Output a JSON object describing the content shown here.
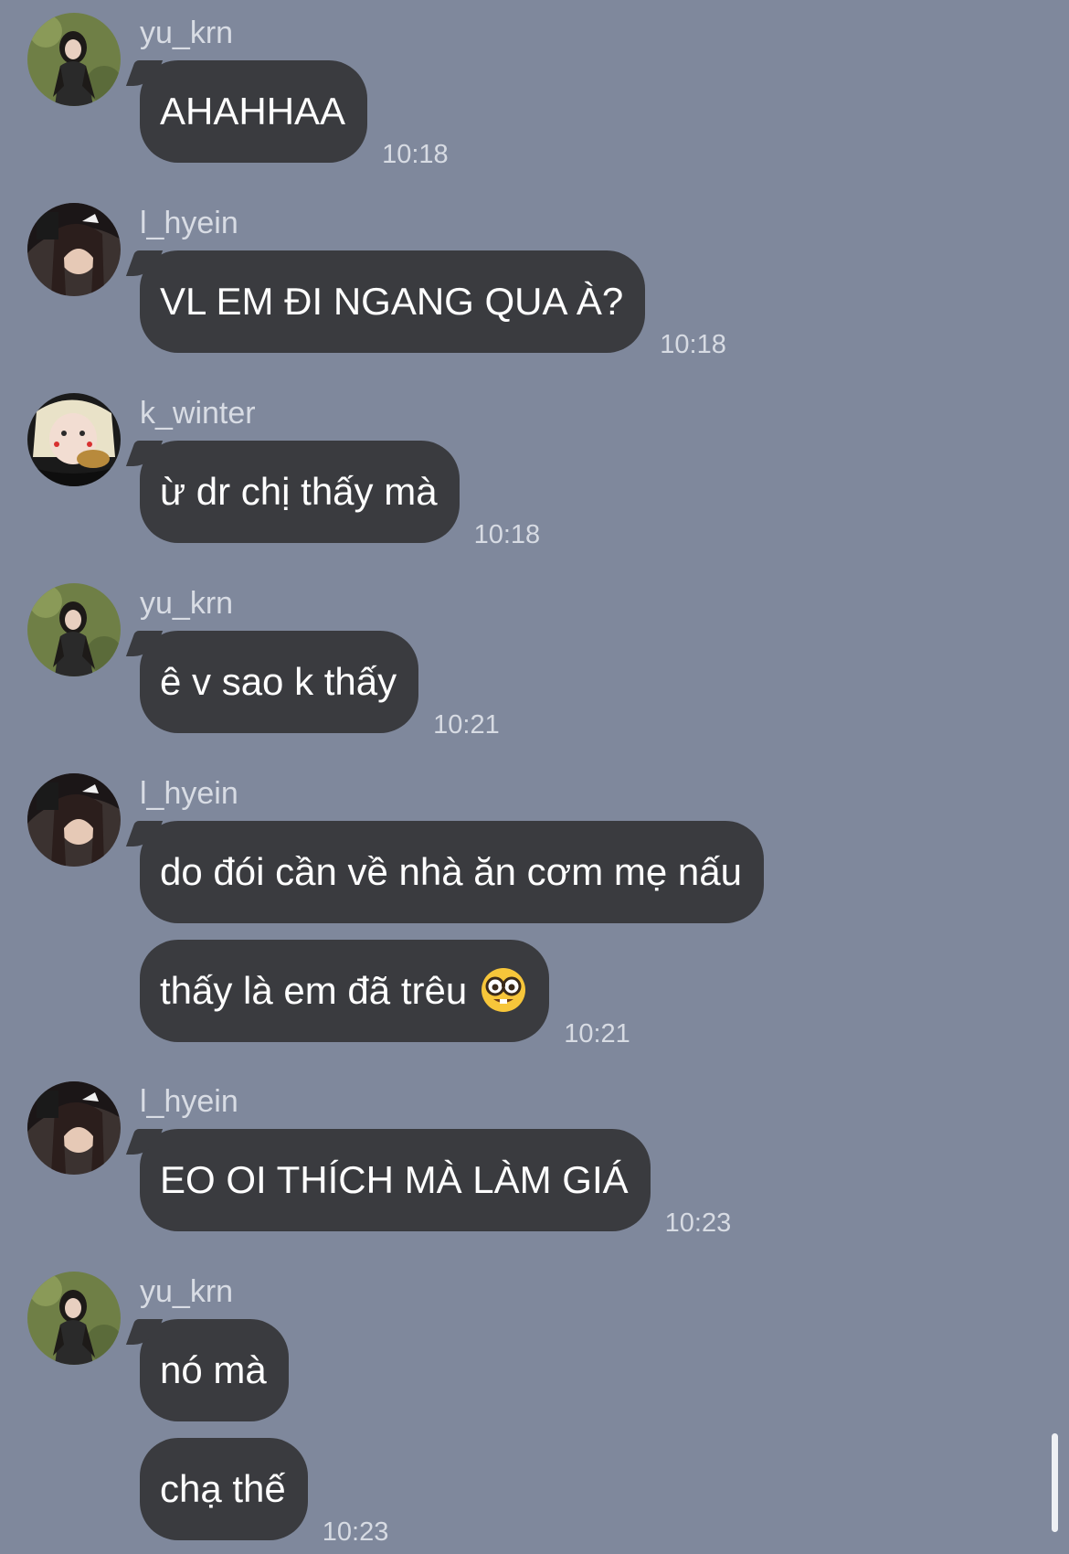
{
  "colors": {
    "background": "#7f889c",
    "bubble": "#3a3b3f",
    "bubble_text": "#ffffff",
    "meta_text": "#d7dbe3"
  },
  "messages": [
    {
      "user": "yu_krn",
      "avatar": "avatar-yu_krn",
      "bubbles": [
        "AHAHHAA"
      ],
      "time": "10:18"
    },
    {
      "user": "l_hyein",
      "avatar": "avatar-l_hyein",
      "bubbles": [
        "VL EM ĐI NGANG QUA À?"
      ],
      "time": "10:18"
    },
    {
      "user": "k_winter",
      "avatar": "avatar-k_winter",
      "bubbles": [
        "ừ dr chị thấy mà"
      ],
      "time": "10:18"
    },
    {
      "user": "yu_krn",
      "avatar": "avatar-yu_krn",
      "bubbles": [
        "ê v sao k thấy"
      ],
      "time": "10:21"
    },
    {
      "user": "l_hyein",
      "avatar": "avatar-l_hyein",
      "bubbles": [
        "do đói cần về nhà ăn cơm mẹ nấu",
        "thấy là em đã trêu"
      ],
      "emoji": "nerd-face-emoji",
      "time": "10:21"
    },
    {
      "user": "l_hyein",
      "avatar": "avatar-l_hyein",
      "bubbles": [
        "EO OI THÍCH MÀ LÀM GIÁ"
      ],
      "time": "10:23"
    },
    {
      "user": "yu_krn",
      "avatar": "avatar-yu_krn",
      "bubbles": [
        "nó mà",
        "chạ thế"
      ],
      "time": "10:23"
    }
  ]
}
